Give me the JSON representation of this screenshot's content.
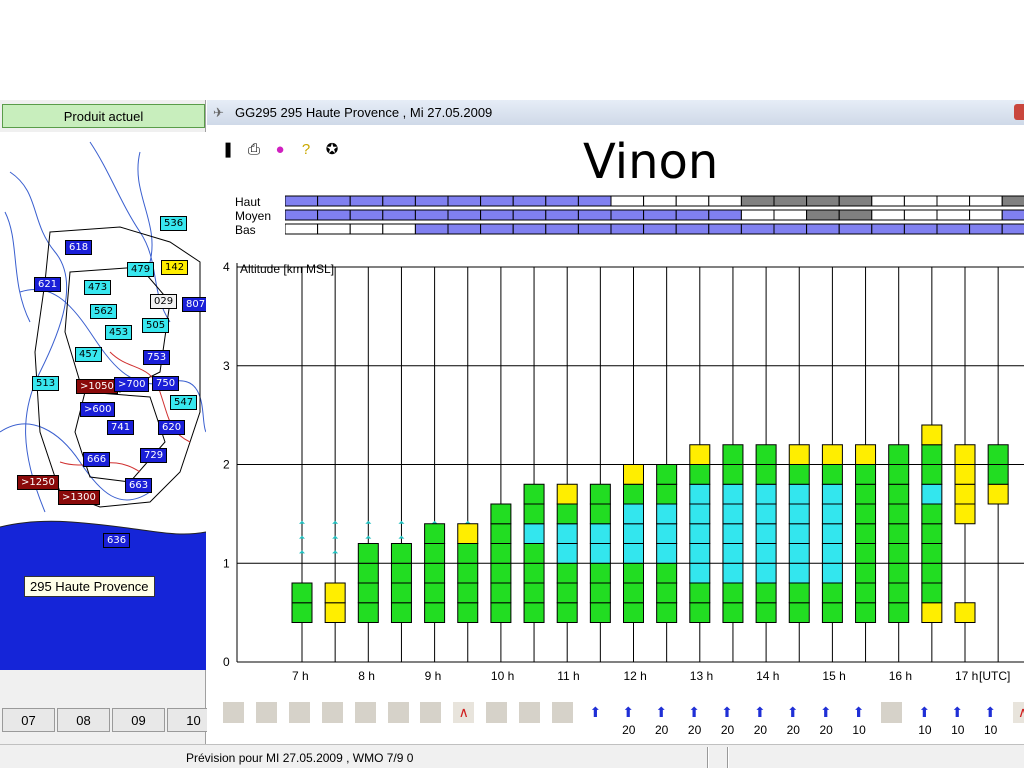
{
  "left_panel": {
    "header": "Produit actuel",
    "tooltip": "295 Haute Provence",
    "regions": [
      {
        "label": "536",
        "style": "cyan"
      },
      {
        "label": "618",
        "style": "blue"
      },
      {
        "label": "479",
        "style": "cyan"
      },
      {
        "label": "142",
        "style": "yellow"
      },
      {
        "label": "621",
        "style": "blue"
      },
      {
        "label": "473",
        "style": "cyan"
      },
      {
        "label": "029",
        "style": "white"
      },
      {
        "label": "807",
        "style": "blue"
      },
      {
        "label": "562",
        "style": "cyan"
      },
      {
        "label": "453",
        "style": "cyan"
      },
      {
        "label": "505",
        "style": "cyan"
      },
      {
        "label": "457",
        "style": "cyan"
      },
      {
        "label": "753",
        "style": "blue"
      },
      {
        "label": "513",
        "style": "cyan"
      },
      {
        "label": ">1050",
        "style": "maroon"
      },
      {
        "label": ">700",
        "style": "blue"
      },
      {
        "label": "750",
        "style": "blue"
      },
      {
        "label": "547",
        "style": "cyan"
      },
      {
        "label": ">600",
        "style": "blue"
      },
      {
        "label": "741",
        "style": "blue"
      },
      {
        "label": "620",
        "style": "blue"
      },
      {
        "label": "666",
        "style": "blue"
      },
      {
        "label": "729",
        "style": "blue"
      },
      {
        "label": ">1250",
        "style": "maroon"
      },
      {
        "label": ">1300",
        "style": "maroon"
      },
      {
        "label": "663",
        "style": "blue"
      },
      {
        "label": "636",
        "style": "blue"
      }
    ],
    "hour_tabs": [
      "07",
      "08",
      "09",
      "10"
    ]
  },
  "window": {
    "title": "GG295  295 Haute Provence , Mi 27.05.2009",
    "big_title": "Vinon",
    "toolbar_icons": [
      "pen-icon",
      "printer-icon",
      "info-icon",
      "help-icon",
      "about-icon"
    ]
  },
  "cloud_layers": {
    "labels": [
      "Haut",
      "Moyen",
      "Bas"
    ],
    "segments": [
      [
        "blue",
        "blue",
        "blue",
        "blue",
        "blue",
        "blue",
        "blue",
        "blue",
        "blue",
        "blue",
        "white",
        "white",
        "white",
        "white",
        "grey",
        "grey",
        "grey",
        "grey",
        "white",
        "white",
        "white",
        "white",
        "grey"
      ],
      [
        "blue",
        "blue",
        "blue",
        "blue",
        "blue",
        "blue",
        "blue",
        "blue",
        "blue",
        "blue",
        "blue",
        "blue",
        "blue",
        "blue",
        "white",
        "white",
        "grey",
        "grey",
        "white",
        "white",
        "white",
        "white",
        "blue"
      ],
      [
        "white",
        "white",
        "white",
        "white",
        "blue",
        "blue",
        "blue",
        "blue",
        "blue",
        "blue",
        "blue",
        "blue",
        "blue",
        "blue",
        "blue",
        "blue",
        "blue",
        "blue",
        "blue",
        "blue",
        "blue",
        "blue",
        "blue"
      ]
    ],
    "colors": {
      "blue": "#8080f0",
      "white": "#ffffff",
      "grey": "#808080"
    }
  },
  "chart_data": {
    "type": "bar",
    "ylabel": "Altitude [km MSL]",
    "xunit": "[UTC]",
    "ylim": [
      0,
      4
    ],
    "yticks": [
      "0",
      "1",
      "2",
      "3",
      "4"
    ],
    "xticks": [
      "7 h",
      "8 h",
      "9 h",
      "10 h",
      "11 h",
      "12 h",
      "13 h",
      "14 h",
      "15 h",
      "16 h",
      "17 h"
    ],
    "colors": {
      "green": "#22dd22",
      "cyan": "#33e6ee",
      "yellow": "#ffee00"
    },
    "columns": [
      {
        "time": 7.0,
        "cells": [
          "green",
          "green"
        ]
      },
      {
        "time": 7.5,
        "cells": [
          "yellow",
          "yellow"
        ]
      },
      {
        "time": 8.0,
        "cells": [
          "green",
          "green",
          "green",
          "green"
        ]
      },
      {
        "time": 8.5,
        "cells": [
          "green",
          "green",
          "green",
          "green"
        ]
      },
      {
        "time": 9.0,
        "cells": [
          "green",
          "green",
          "green",
          "green",
          "green"
        ]
      },
      {
        "time": 9.5,
        "cells": [
          "green",
          "green",
          "green",
          "green",
          "yellow"
        ]
      },
      {
        "time": 10.0,
        "cells": [
          "green",
          "green",
          "green",
          "green",
          "green",
          "green"
        ]
      },
      {
        "time": 10.5,
        "cells": [
          "green",
          "green",
          "green",
          "green",
          "cyan",
          "green",
          "green"
        ]
      },
      {
        "time": 11.0,
        "cells": [
          "green",
          "green",
          "green",
          "cyan",
          "cyan",
          "green",
          "yellow"
        ]
      },
      {
        "time": 11.5,
        "cells": [
          "green",
          "green",
          "green",
          "cyan",
          "cyan",
          "green",
          "green"
        ]
      },
      {
        "time": 12.0,
        "cells": [
          "green",
          "green",
          "green",
          "cyan",
          "cyan",
          "cyan",
          "green",
          "yellow"
        ]
      },
      {
        "time": 12.5,
        "cells": [
          "green",
          "green",
          "green",
          "cyan",
          "cyan",
          "cyan",
          "green",
          "green"
        ]
      },
      {
        "time": 13.0,
        "cells": [
          "green",
          "green",
          "cyan",
          "cyan",
          "cyan",
          "cyan",
          "cyan",
          "green",
          "yellow"
        ]
      },
      {
        "time": 13.5,
        "cells": [
          "green",
          "green",
          "cyan",
          "cyan",
          "cyan",
          "cyan",
          "cyan",
          "green",
          "green"
        ]
      },
      {
        "time": 14.0,
        "cells": [
          "green",
          "green",
          "cyan",
          "cyan",
          "cyan",
          "cyan",
          "cyan",
          "green",
          "green"
        ]
      },
      {
        "time": 14.5,
        "cells": [
          "green",
          "green",
          "cyan",
          "cyan",
          "cyan",
          "cyan",
          "cyan",
          "green",
          "yellow"
        ]
      },
      {
        "time": 15.0,
        "cells": [
          "green",
          "green",
          "cyan",
          "cyan",
          "cyan",
          "cyan",
          "cyan",
          "green",
          "yellow"
        ]
      },
      {
        "time": 15.5,
        "cells": [
          "green",
          "green",
          "green",
          "green",
          "green",
          "green",
          "green",
          "green",
          "yellow"
        ]
      },
      {
        "time": 16.0,
        "cells": [
          "green",
          "green",
          "green",
          "green",
          "green",
          "green",
          "green",
          "green",
          "green"
        ]
      },
      {
        "time": 16.5,
        "cells": [
          "yellow",
          "green",
          "green",
          "green",
          "green",
          "green",
          "cyan",
          "green",
          "green",
          "yellow"
        ]
      },
      {
        "time": 17.0,
        "top": 2.2,
        "bottom": 1.4,
        "cells": [
          "yellow",
          "yellow",
          "yellow",
          "yellow"
        ]
      },
      {
        "time": 17.0,
        "top": 0.6,
        "bottom": 0.4,
        "cells": [
          "yellow"
        ]
      },
      {
        "time": 17.5,
        "top": 2.2,
        "bottom": 1.6,
        "cells": [
          "yellow",
          "green",
          "green"
        ]
      }
    ]
  },
  "wind_row": {
    "cells": [
      {
        "type": "grey"
      },
      {
        "type": "grey"
      },
      {
        "type": "grey"
      },
      {
        "type": "grey"
      },
      {
        "type": "grey"
      },
      {
        "type": "grey"
      },
      {
        "type": "grey"
      },
      {
        "type": "lift"
      },
      {
        "type": "grey"
      },
      {
        "type": "grey"
      },
      {
        "type": "grey"
      },
      {
        "type": "arrow",
        "value": ""
      },
      {
        "type": "arrow",
        "value": "20"
      },
      {
        "type": "arrow",
        "value": "20"
      },
      {
        "type": "arrow",
        "value": "20"
      },
      {
        "type": "arrow",
        "value": "20"
      },
      {
        "type": "arrow",
        "value": "20"
      },
      {
        "type": "arrow",
        "value": "20"
      },
      {
        "type": "arrow",
        "value": "20"
      },
      {
        "type": "arrow",
        "value": "10"
      },
      {
        "type": "grey"
      },
      {
        "type": "arrow",
        "value": "10"
      },
      {
        "type": "arrow",
        "value": "10"
      },
      {
        "type": "arrow",
        "value": "10"
      },
      {
        "type": "lift"
      }
    ]
  },
  "statusbar": {
    "text": "Prévision pour  MI 27.05.2009 , WMO 7/9 0"
  }
}
